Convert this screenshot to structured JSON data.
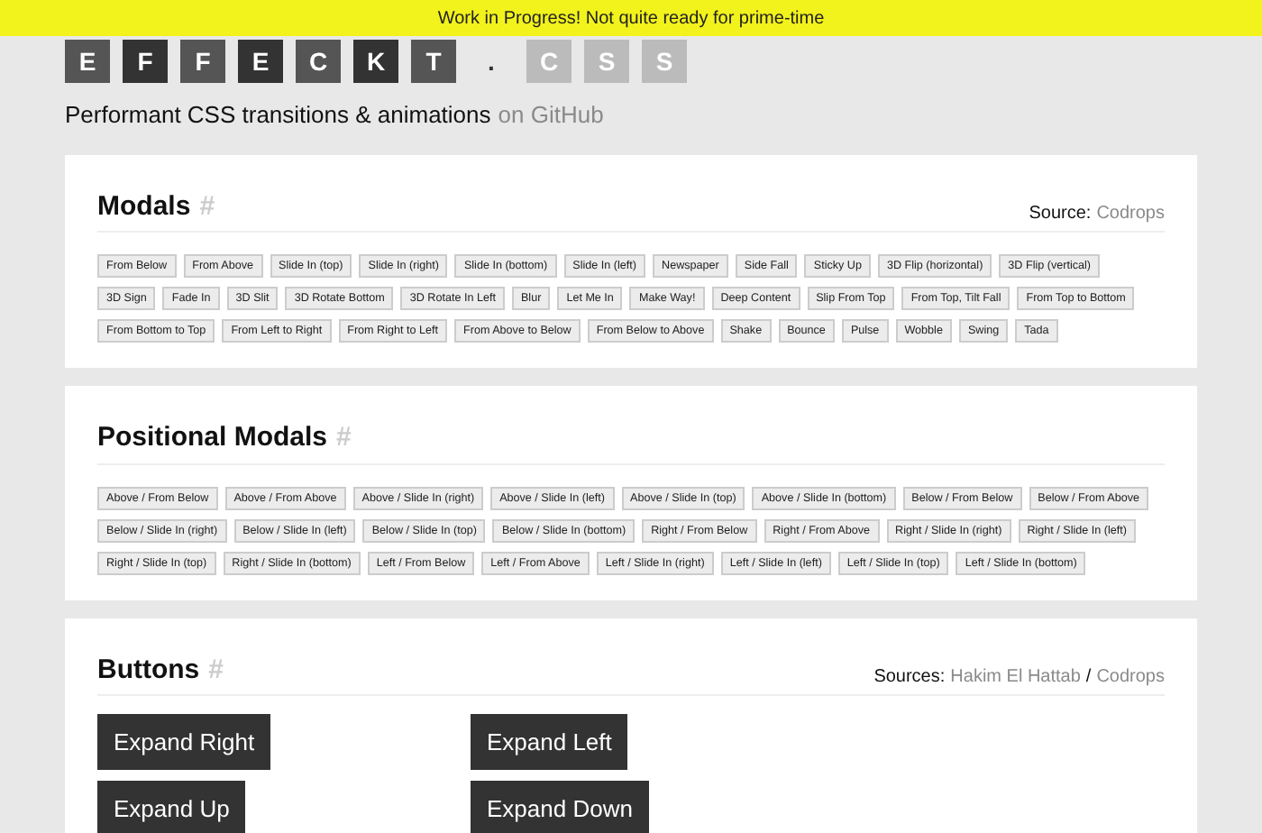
{
  "banner": {
    "text": "Work in Progress! Not quite ready for prime-time"
  },
  "logo": [
    {
      "char": "E",
      "kind": "tile",
      "color": "#555555"
    },
    {
      "char": "F",
      "kind": "tile",
      "color": "#333333"
    },
    {
      "char": "F",
      "kind": "tile",
      "color": "#555555"
    },
    {
      "char": "E",
      "kind": "tile",
      "color": "#333333"
    },
    {
      "char": "C",
      "kind": "tile",
      "color": "#555555"
    },
    {
      "char": "K",
      "kind": "tile",
      "color": "#333333"
    },
    {
      "char": "T",
      "kind": "tile",
      "color": "#555555"
    },
    {
      "char": ".",
      "kind": "dot",
      "color": "#333333"
    },
    {
      "char": "C",
      "kind": "tile",
      "color": "#bbbbbb"
    },
    {
      "char": "S",
      "kind": "tile",
      "color": "#bbbbbb"
    },
    {
      "char": "S",
      "kind": "tile",
      "color": "#bbbbbb"
    }
  ],
  "tagline": {
    "text": "Performant CSS transitions & animations",
    "link": "on GitHub"
  },
  "sections": [
    {
      "title": "Modals",
      "anchor": "#",
      "kind": "chips",
      "source_label": "Source:",
      "sources": [
        "Codrops"
      ],
      "items": [
        "From Below",
        "From Above",
        "Slide In (top)",
        "Slide In (right)",
        "Slide In (bottom)",
        "Slide In (left)",
        "Newspaper",
        "Side Fall",
        "Sticky Up",
        "3D Flip (horizontal)",
        "3D Flip (vertical)",
        "3D Sign",
        "Fade In",
        "3D Slit",
        "3D Rotate Bottom",
        "3D Rotate In Left",
        "Blur",
        "Let Me In",
        "Make Way!",
        "Deep Content",
        "Slip From Top",
        "From Top, Tilt Fall",
        "From Top to Bottom",
        "From Bottom to Top",
        "From Left to Right",
        "From Right to Left",
        "From Above to Below",
        "From Below to Above",
        "Shake",
        "Bounce",
        "Pulse",
        "Wobble",
        "Swing",
        "Tada"
      ]
    },
    {
      "title": "Positional Modals",
      "anchor": "#",
      "kind": "chips",
      "items": [
        "Above / From Below",
        "Above / From Above",
        "Above / Slide In (right)",
        "Above / Slide In (left)",
        "Above / Slide In (top)",
        "Above / Slide In (bottom)",
        "Below / From Below",
        "Below / From Above",
        "Below / Slide In (right)",
        "Below / Slide In (left)",
        "Below / Slide In (top)",
        "Below / Slide In (bottom)",
        "Right / From Below",
        "Right / From Above",
        "Right / Slide In (right)",
        "Right / Slide In (left)",
        "Right / Slide In (top)",
        "Right / Slide In (bottom)",
        "Left / From Below",
        "Left / From Above",
        "Left / Slide In (right)",
        "Left / Slide In (left)",
        "Left / Slide In (top)",
        "Left / Slide In (bottom)"
      ]
    },
    {
      "title": "Buttons",
      "anchor": "#",
      "kind": "buttons",
      "source_label": "Sources:",
      "sources": [
        "Hakim El Hattab",
        "Codrops"
      ],
      "source_separator": "/",
      "items": [
        "Expand Right",
        "Expand Left",
        "Expand Up",
        "Expand Down"
      ]
    }
  ]
}
